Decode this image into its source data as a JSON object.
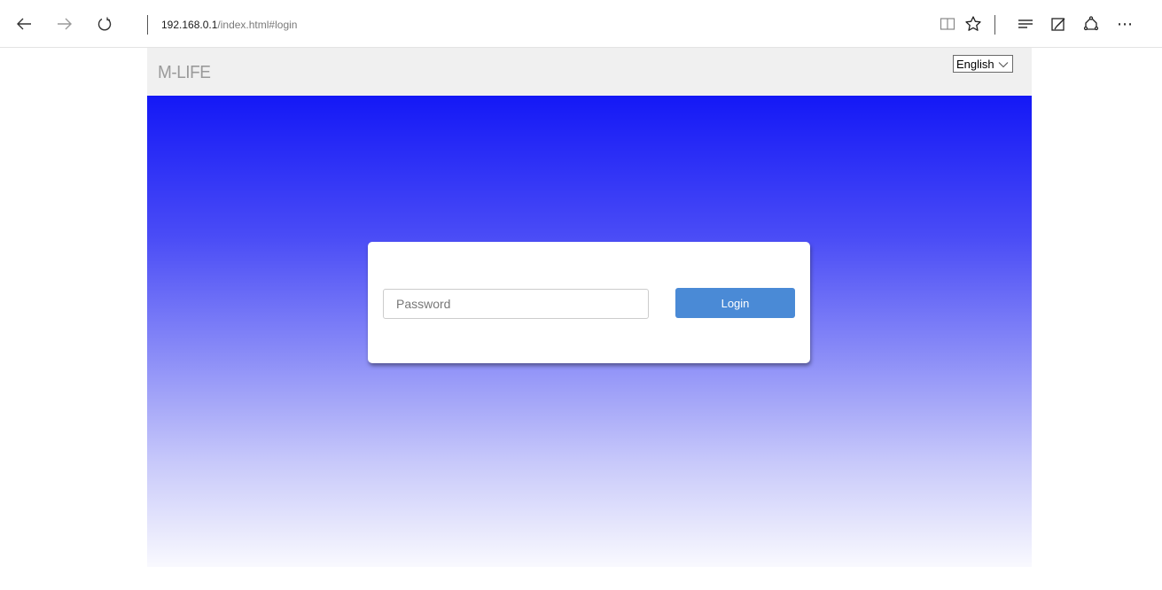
{
  "browser": {
    "address": {
      "host": "192.168.0.1",
      "path": "/index.html#login"
    },
    "icons": {
      "back": "back-arrow-icon",
      "forward": "forward-arrow-icon",
      "refresh": "refresh-icon",
      "reading_view": "reading-view-icon",
      "favorite": "star-icon",
      "hub": "hub-icon",
      "web_note": "web-note-icon",
      "share": "share-icon",
      "more": "more-icon"
    },
    "more_label": "⋯"
  },
  "page": {
    "logo": "M-LIFE",
    "language": {
      "selected": "English"
    },
    "login": {
      "password_placeholder": "Password",
      "button_label": "Login"
    }
  },
  "colors": {
    "hero_top": "#1418f6",
    "hero_bottom": "#f9f9fe",
    "login_button": "#4a8ad6",
    "header_bg": "#f0f0f0"
  }
}
